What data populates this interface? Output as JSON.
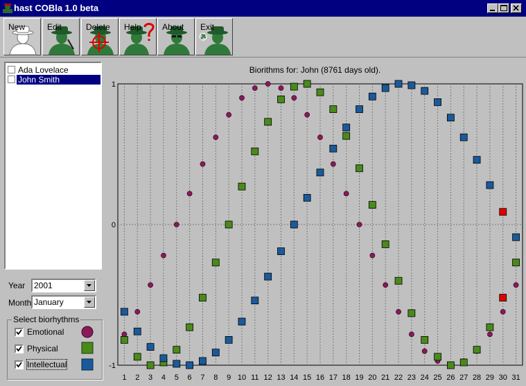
{
  "window": {
    "title": "hast COBla 1.0 beta"
  },
  "toolbar": {
    "buttons": [
      {
        "label": "New",
        "icon": "agent-new-icon"
      },
      {
        "label": "Edit",
        "icon": "agent-edit-icon"
      },
      {
        "label": "Delete",
        "icon": "agent-delete-icon"
      },
      {
        "label": "Help",
        "icon": "agent-help-icon"
      },
      {
        "label": "About",
        "icon": "agent-about-icon"
      },
      {
        "label": "Exit",
        "icon": "agent-exit-icon"
      }
    ]
  },
  "people": [
    {
      "name": "Ada Lovelace",
      "checked": false,
      "selected": false
    },
    {
      "name": "John Smith",
      "checked": false,
      "selected": true
    }
  ],
  "controls": {
    "year_label": "Year",
    "year_value": "2001",
    "month_label": "Month",
    "month_value": "January"
  },
  "biorhythms": {
    "group_label": "Select biorhythms",
    "items": [
      {
        "label": "Emotional",
        "checked": true,
        "color": "#8b1a5a",
        "shape": "circle"
      },
      {
        "label": "Physical",
        "checked": true,
        "color": "#4a8a1a",
        "shape": "square"
      },
      {
        "label": "Intellectual",
        "checked": true,
        "color": "#1a5a9a",
        "shape": "square"
      }
    ]
  },
  "chart_data": {
    "type": "scatter",
    "title": "Biorithms for: John (8761 days old).",
    "x": [
      1,
      2,
      3,
      4,
      5,
      6,
      7,
      8,
      9,
      10,
      11,
      12,
      13,
      14,
      15,
      16,
      17,
      18,
      19,
      20,
      21,
      22,
      23,
      24,
      25,
      26,
      27,
      28,
      29,
      30,
      31
    ],
    "ylim": [
      -1,
      1
    ],
    "y_ticks": [
      "1",
      "0",
      "-1"
    ],
    "grid": true,
    "highlight_day": 30,
    "highlight_color": "#e00000",
    "series": [
      {
        "name": "Emotional",
        "color": "#8b1a5a",
        "marker": "circle",
        "values": [
          -0.78,
          -0.62,
          -0.43,
          -0.22,
          0.0,
          0.22,
          0.43,
          0.62,
          0.78,
          0.9,
          0.97,
          1.0,
          0.97,
          0.9,
          0.78,
          0.62,
          0.43,
          0.22,
          0.0,
          -0.22,
          -0.43,
          -0.62,
          -0.78,
          -0.9,
          -0.97,
          -1.0,
          -0.97,
          -0.9,
          -0.78,
          -0.62,
          -0.43
        ]
      },
      {
        "name": "Physical",
        "color": "#4a8a1a",
        "marker": "square",
        "values": [
          -0.82,
          -0.94,
          -1.0,
          -0.98,
          -0.89,
          -0.73,
          -0.52,
          -0.27,
          0.0,
          0.27,
          0.52,
          0.73,
          0.89,
          0.98,
          1.0,
          0.94,
          0.82,
          0.63,
          0.4,
          0.14,
          -0.14,
          -0.4,
          -0.63,
          -0.82,
          -0.94,
          -1.0,
          -0.98,
          -0.89,
          -0.73,
          -0.52,
          -0.27
        ]
      },
      {
        "name": "Intellectual",
        "color": "#1a5a9a",
        "marker": "square",
        "values": [
          -0.62,
          -0.76,
          -0.87,
          -0.95,
          -0.99,
          -1.0,
          -0.97,
          -0.91,
          -0.82,
          -0.69,
          -0.54,
          -0.37,
          -0.19,
          0.0,
          0.19,
          0.37,
          0.54,
          0.69,
          0.82,
          0.91,
          0.97,
          1.0,
          0.99,
          0.95,
          0.87,
          0.76,
          0.62,
          0.46,
          0.28,
          0.09,
          -0.09
        ]
      }
    ]
  }
}
